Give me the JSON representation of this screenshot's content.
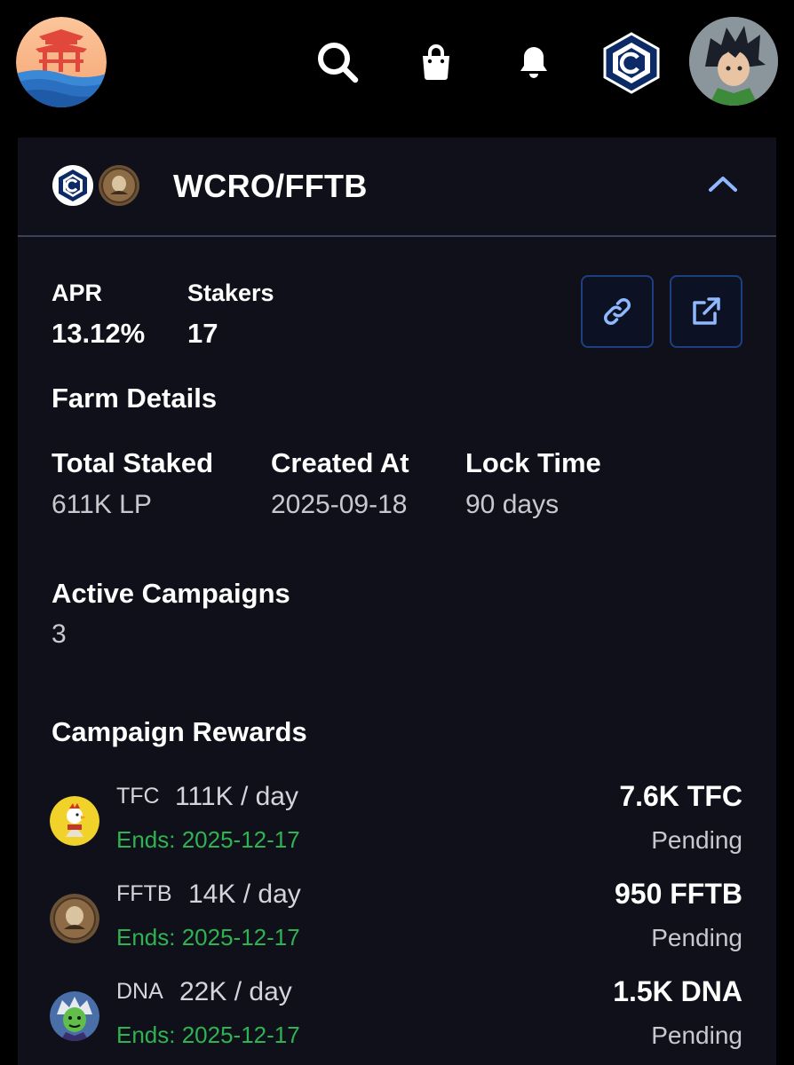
{
  "colors": {
    "background": "#000000",
    "card": "#0f1019",
    "accent_blue": "#8fb8ff",
    "green": "#2fb352",
    "muted_text": "#c8c9cf"
  },
  "topbar": {
    "icons": [
      "app-logo",
      "search-icon",
      "shopping-bag-icon",
      "bell-icon",
      "cronos-icon",
      "user-avatar"
    ]
  },
  "pool": {
    "title": "WCRO/FFTB",
    "icons": [
      "cronos-token-icon",
      "fftb-token-icon"
    ],
    "collapse_icon": "chevron-up-icon"
  },
  "stats": {
    "apr_label": "APR",
    "apr_value": "13.12%",
    "stakers_label": "Stakers",
    "stakers_value": "17"
  },
  "actions": {
    "copy_link_icon": "link-icon",
    "open_external_icon": "external-link-icon"
  },
  "farm_details": {
    "title": "Farm Details",
    "total_staked_label": "Total Staked",
    "total_staked_value": "611K LP",
    "created_at_label": "Created At",
    "created_at_value": "2025-09-18",
    "lock_time_label": "Lock Time",
    "lock_time_value": "90 days"
  },
  "active_campaigns": {
    "label": "Active Campaigns",
    "value": "3"
  },
  "campaign_rewards": {
    "title": "Campaign Rewards",
    "items": [
      {
        "token": "TFC",
        "rate": "111K / day",
        "ends": "Ends: 2025-12-17",
        "amount": "7.6K TFC",
        "status": "Pending",
        "icon": "tfc-token-icon"
      },
      {
        "token": "FFTB",
        "rate": "14K / day",
        "ends": "Ends: 2025-12-17",
        "amount": "950 FFTB",
        "status": "Pending",
        "icon": "fftb-token-icon"
      },
      {
        "token": "DNA",
        "rate": "22K / day",
        "ends": "Ends: 2025-12-17",
        "amount": "1.5K DNA",
        "status": "Pending",
        "icon": "dna-token-icon"
      }
    ]
  }
}
